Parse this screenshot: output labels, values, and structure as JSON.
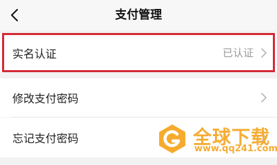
{
  "nav": {
    "title": "支付管理",
    "back_icon": "chevron-left-icon"
  },
  "rows": [
    {
      "label": "实名认证",
      "value": "已认证",
      "icon": "chevron-right-icon",
      "highlighted": true
    },
    {
      "label": "修改支付密码",
      "value": "",
      "icon": "chevron-right-icon"
    },
    {
      "label": "忘记支付密码",
      "value": "",
      "icon": "chevron-right-icon"
    }
  ],
  "watermark": {
    "title": "全球下载",
    "url": "www.qq241.com"
  },
  "colors": {
    "highlight": "#d42a35",
    "watermark": "#f5a623",
    "value_text": "#9a9a9a",
    "background": "#f2f2f2"
  }
}
